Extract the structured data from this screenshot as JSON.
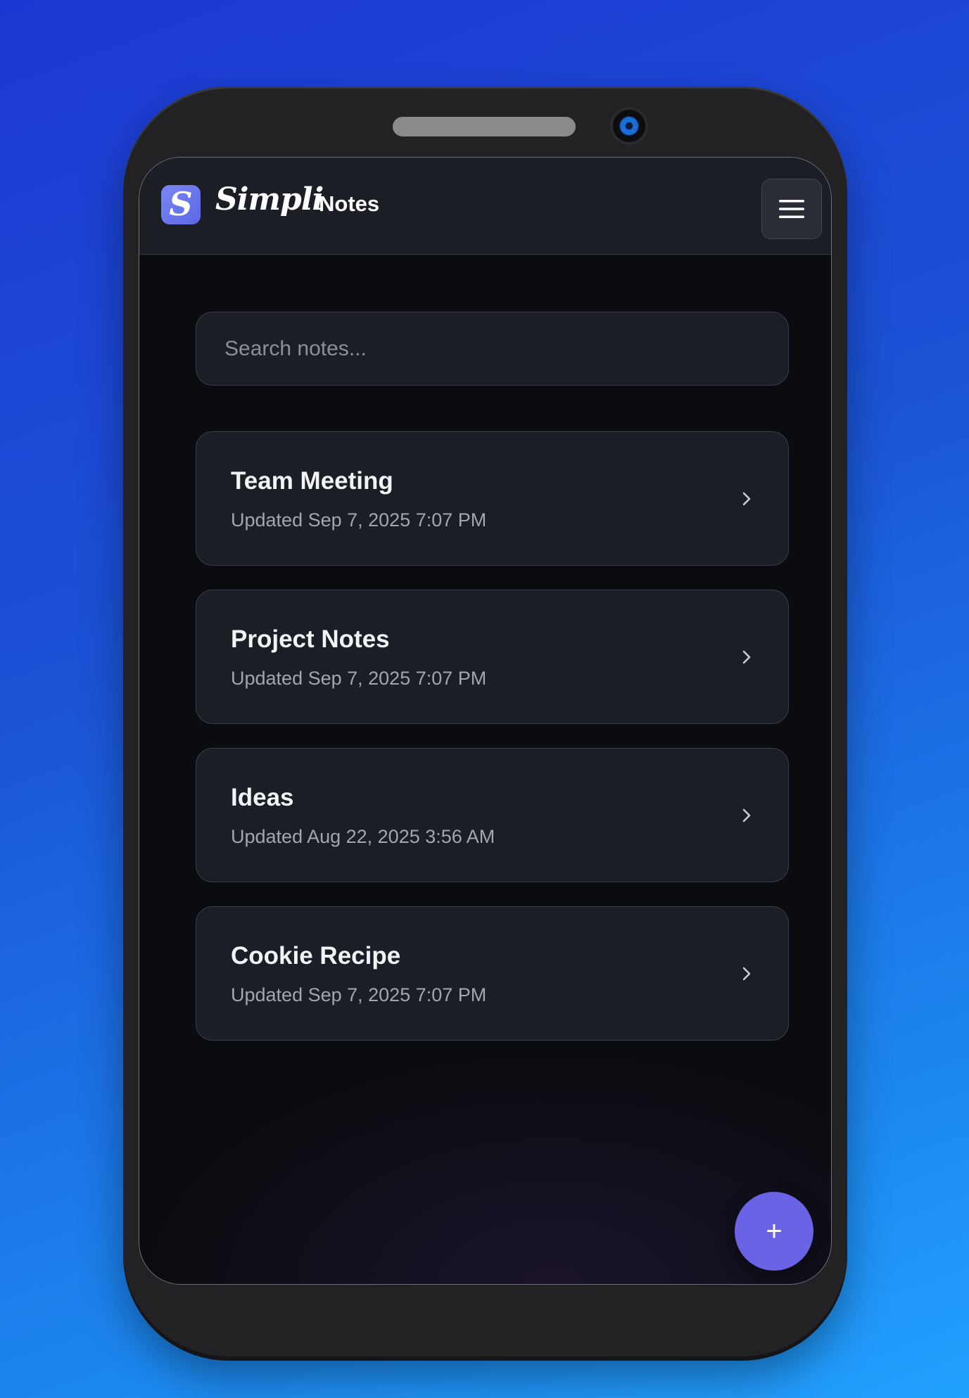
{
  "header": {
    "logo_letter": "S",
    "brand": "Simpli",
    "app_name": "Notes"
  },
  "search": {
    "placeholder": "Search notes..."
  },
  "notes": [
    {
      "title": "Team Meeting",
      "updated": "Updated Sep 7, 2025 7:07 PM"
    },
    {
      "title": "Project Notes",
      "updated": "Updated Sep 7, 2025 7:07 PM"
    },
    {
      "title": "Ideas",
      "updated": "Updated Aug 22, 2025 3:56 AM"
    },
    {
      "title": "Cookie Recipe",
      "updated": "Updated Sep 7, 2025 7:07 PM"
    }
  ],
  "fab": {
    "label": "+"
  },
  "icons": {
    "menu": "hamburger-menu-icon",
    "chevron": "chevron-right-icon"
  },
  "colors": {
    "accent": "#6a63e6",
    "logo": "#6c78ee",
    "card_bg": "#1c1e25",
    "screen_bg": "#0b0c10"
  }
}
